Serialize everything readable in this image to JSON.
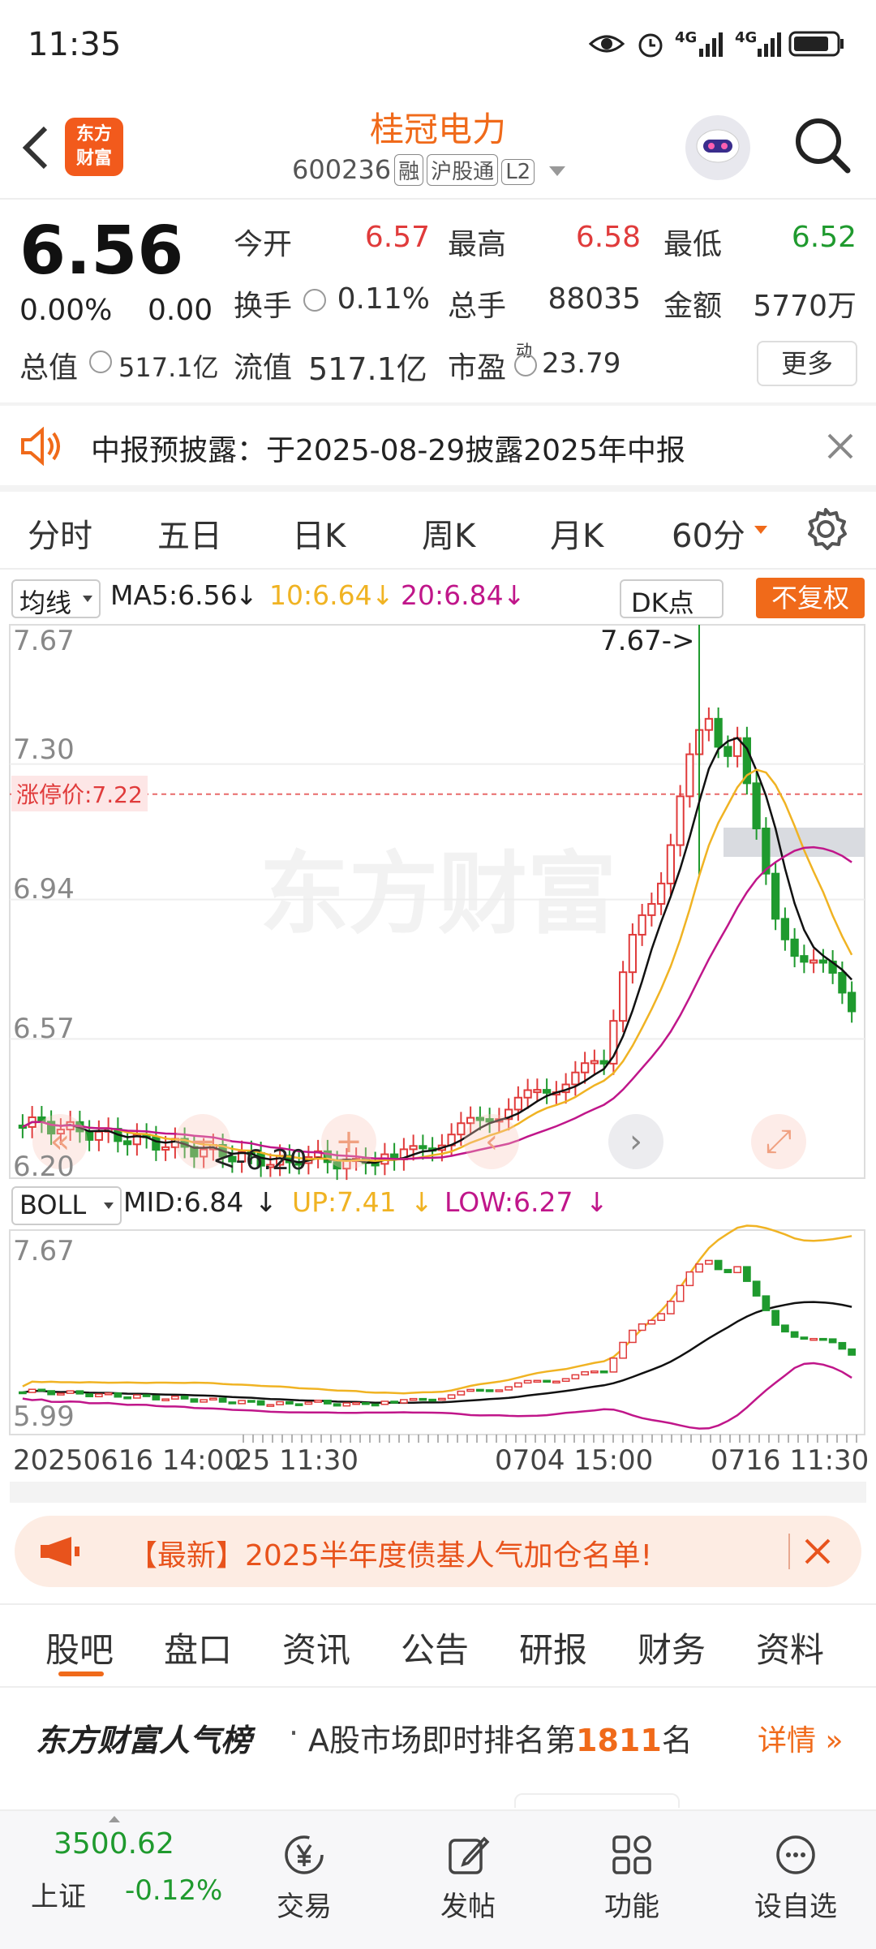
{
  "status_bar": {
    "time": "11:35",
    "net1": "4G",
    "net2": "4G"
  },
  "header": {
    "logo_line1": "东方",
    "logo_line2": "财富",
    "stock_name": "桂冠电力",
    "code": "600236",
    "tags": [
      "融",
      "沪股通",
      "L2"
    ]
  },
  "quote": {
    "price": "6.56",
    "change_pct": "0.00%",
    "change": "0.00",
    "open_label": "今开",
    "open": "6.57",
    "high_label": "最高",
    "high": "6.58",
    "low_label": "最低",
    "low": "6.52",
    "turnover_label": "换手",
    "turnover": "0.11%",
    "volume_label": "总手",
    "volume": "88035",
    "amount_label": "金额",
    "amount": "5770万",
    "mktcap_label": "总值",
    "mktcap": "517.1亿",
    "float_label": "流值",
    "float_cap": "517.1亿",
    "pe_label": "市盈",
    "pe_sup": "动",
    "pe": "23.79",
    "more": "更多"
  },
  "notice": {
    "text": "中报预披露：于2025-08-29披露2025年中报"
  },
  "period_tabs": [
    "分时",
    "五日",
    "日K",
    "周K",
    "月K",
    "60分"
  ],
  "main_indicator": {
    "name": "均线",
    "ma5": "MA5:6.56",
    "ma10": "10:6.64",
    "ma20": "20:6.84",
    "dk": "DK点",
    "fq": "不复权"
  },
  "sub_indicator": {
    "name": "BOLL",
    "mid": "MID:6.84",
    "up": "UP:7.41",
    "low": "LOW:6.27"
  },
  "chart_data": {
    "type": "candlestick",
    "price_axis_ticks": [
      "7.67",
      "7.30",
      "6.94",
      "6.57",
      "6.20"
    ],
    "limit_up_label": "涨停价:7.22",
    "max_annotation": "7.67->",
    "min_annotation": "<-6.20",
    "boll_axis_ticks": [
      "7.67",
      "5.99"
    ],
    "time_labels": [
      "20250616 14:00",
      "25 11:30",
      "0704 15:00",
      "0716 11:30"
    ],
    "watermark": "东方财富",
    "colors": {
      "up": "#e03b3b",
      "down": "#1f9a2e",
      "ma5": "#111111",
      "ma10": "#f0b323",
      "ma20": "#c0168a"
    }
  },
  "banner": {
    "text": "【最新】2025半年度债基人气加仓名单!"
  },
  "bottom_tabs": [
    "股吧",
    "盘口",
    "资讯",
    "公告",
    "研报",
    "财务",
    "资料"
  ],
  "rank": {
    "brand": "东方财富人气榜",
    "text_prefix": "A股市场即时排名第",
    "rank": "1811",
    "text_suffix": "名",
    "link": "详情"
  },
  "bottom_bar": {
    "index_value": "3500.62",
    "index_name": "上证",
    "index_change": "-0.12%",
    "items": [
      "交易",
      "发帖",
      "功能",
      "设自选"
    ]
  }
}
